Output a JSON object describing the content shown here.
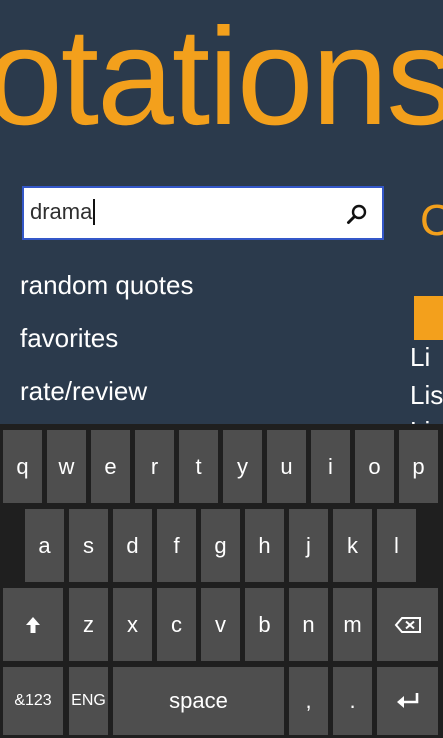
{
  "app": {
    "title": "otations",
    "search": {
      "value": "drama",
      "icon": "search-icon"
    },
    "menu": [
      {
        "label": "random quotes"
      },
      {
        "label": "favorites"
      },
      {
        "label": "rate/review"
      }
    ],
    "next_panel": {
      "heading_peek": "C",
      "lines": [
        "Li",
        "Lis",
        "Li"
      ]
    },
    "colors": {
      "accent": "#f3a01c",
      "background": "#2b3a4c",
      "key": "#4e4e4e",
      "keyboard_bg": "#1f1f1f",
      "search_border": "#3457c8"
    }
  },
  "keyboard": {
    "row1": [
      "q",
      "w",
      "e",
      "r",
      "t",
      "y",
      "u",
      "i",
      "o",
      "p"
    ],
    "row2": [
      "a",
      "s",
      "d",
      "f",
      "g",
      "h",
      "j",
      "k",
      "l"
    ],
    "row3": [
      "z",
      "x",
      "c",
      "v",
      "b",
      "n",
      "m"
    ],
    "shift_icon": "shift-arrow-icon",
    "backspace_icon": "backspace-icon",
    "symbols_label": "&123",
    "language_label": "ENG",
    "space_label": "space",
    "comma_label": ",",
    "period_label": ".",
    "enter_icon": "enter-icon"
  }
}
